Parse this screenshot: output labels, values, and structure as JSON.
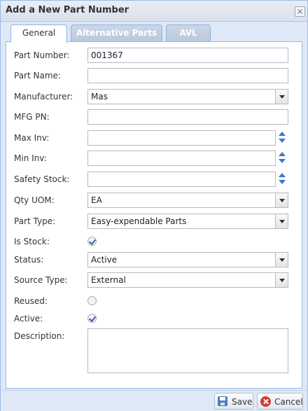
{
  "window": {
    "title": "Add a New Part Number"
  },
  "tabs": [
    {
      "label": "General",
      "active": true
    },
    {
      "label": "Alternative Parts",
      "active": false
    },
    {
      "label": "AVL",
      "active": false
    }
  ],
  "form": {
    "part_number": {
      "label": "Part Number:",
      "value": "001367"
    },
    "part_name": {
      "label": "Part Name:",
      "value": ""
    },
    "manufacturer": {
      "label": "Manufacturer:",
      "value": "Mas"
    },
    "mfg_pn": {
      "label": "MFG PN:",
      "value": ""
    },
    "max_inv": {
      "label": "Max Inv:",
      "value": ""
    },
    "min_inv": {
      "label": "Min Inv:",
      "value": ""
    },
    "safety_stock": {
      "label": "Safety Stock:",
      "value": ""
    },
    "qty_uom": {
      "label": "Qty UOM:",
      "value": "EA"
    },
    "part_type": {
      "label": "Part Type:",
      "value": "Easy-expendable Parts"
    },
    "is_stock": {
      "label": "Is Stock:",
      "checked": true
    },
    "status": {
      "label": "Status:",
      "value": "Active"
    },
    "source_type": {
      "label": "Source Type:",
      "value": "External"
    },
    "reused": {
      "label": "Reused:",
      "checked": false
    },
    "active": {
      "label": "Active:",
      "checked": true
    },
    "description": {
      "label": "Description:",
      "value": ""
    }
  },
  "buttons": {
    "save": "Save",
    "cancel": "Cancel"
  },
  "colors": {
    "accent": "#99bbe8",
    "panel_bg": "#dfe8f6",
    "cancel": "#d23b2f"
  }
}
